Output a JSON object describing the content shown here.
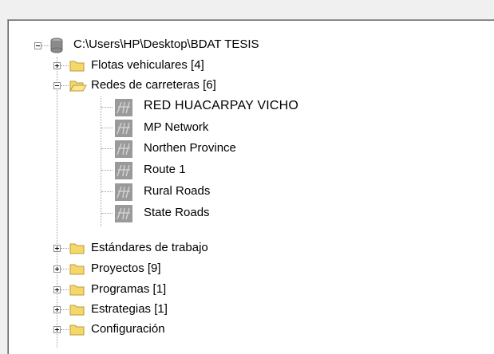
{
  "tree": {
    "root": {
      "label": "C:\\Users\\HP\\Desktop\\BDAT TESIS",
      "icon": "database-icon",
      "expanded": true
    },
    "nodes": [
      {
        "label": "Flotas vehiculares [4]",
        "icon": "folder-icon",
        "expanded": false
      },
      {
        "label": "Redes de carreteras [6]",
        "icon": "folder-open-icon",
        "expanded": true,
        "children": [
          {
            "label": "RED HUACARPAY VICHO",
            "icon": "road-network-icon"
          },
          {
            "label": "MP Network",
            "icon": "road-network-icon"
          },
          {
            "label": "Northen Province",
            "icon": "road-network-icon"
          },
          {
            "label": "Route 1",
            "icon": "road-network-icon"
          },
          {
            "label": "Rural Roads",
            "icon": "road-network-icon"
          },
          {
            "label": "State Roads",
            "icon": "road-network-icon"
          }
        ]
      },
      {
        "label": "Estándares de trabajo",
        "icon": "folder-icon",
        "expanded": false
      },
      {
        "label": "Proyectos [9]",
        "icon": "folder-icon",
        "expanded": false
      },
      {
        "label": "Programas [1]",
        "icon": "folder-icon",
        "expanded": false
      },
      {
        "label": "Estrategias [1]",
        "icon": "folder-icon",
        "expanded": false
      },
      {
        "label": "Configuración",
        "icon": "folder-icon",
        "expanded": false
      }
    ]
  },
  "colors": {
    "folder": "#f6d86a",
    "folder_border": "#b89b3a",
    "db": "#8a8a8a"
  }
}
